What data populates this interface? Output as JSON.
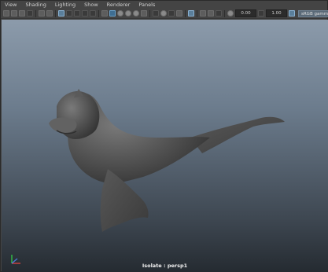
{
  "menu": [
    "View",
    "Shading",
    "Lighting",
    "Show",
    "Renderer",
    "Panels"
  ],
  "toolbar": {
    "exposure_value": "0.00",
    "gamma_value": "1.00",
    "color_management_label": "sRGB gamma"
  },
  "viewport": {
    "hud_label": "Isolate : persp1"
  },
  "colors": {
    "viewport_top": "#8c9bab",
    "viewport_bottom": "#252b31",
    "model": "#4e4e4e"
  }
}
